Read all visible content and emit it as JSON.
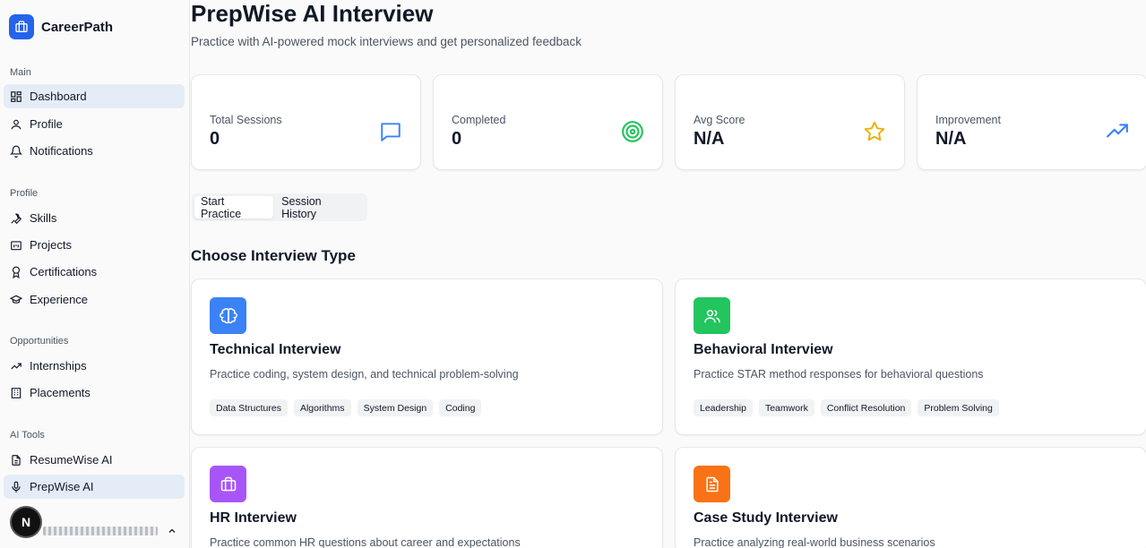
{
  "brand": {
    "name": "CareerPath",
    "color": "#2563eb"
  },
  "sidebar": {
    "sections": [
      {
        "label": "Main"
      },
      {
        "label": "Profile"
      },
      {
        "label": "Opportunities"
      },
      {
        "label": "AI Tools"
      }
    ],
    "items": [
      {
        "label": "Dashboard",
        "icon": "dashboard-icon",
        "active": true
      },
      {
        "label": "Profile",
        "icon": "user-icon"
      },
      {
        "label": "Notifications",
        "icon": "bell-icon"
      },
      {
        "label": "Skills",
        "icon": "wrench-icon"
      },
      {
        "label": "Projects",
        "icon": "folder-icon"
      },
      {
        "label": "Certifications",
        "icon": "award-icon"
      },
      {
        "label": "Experience",
        "icon": "graduation-cap-icon"
      },
      {
        "label": "Internships",
        "icon": "trending-up-icon"
      },
      {
        "label": "Placements",
        "icon": "building-icon"
      },
      {
        "label": "ResumeWise AI",
        "icon": "file-text-icon"
      },
      {
        "label": "PrepWise AI",
        "icon": "mic-icon",
        "active": true
      }
    ],
    "footer": {
      "avatar_letter": "N"
    }
  },
  "header": {
    "title": "PrepWise AI Interview",
    "subtitle": "Practice with AI-powered mock interviews and get personalized feedback"
  },
  "stats": [
    {
      "label": "Total Sessions",
      "value": "0",
      "icon": "message-square-icon",
      "color": "#3b82f6"
    },
    {
      "label": "Completed",
      "value": "0",
      "icon": "target-icon",
      "color": "#22c55e"
    },
    {
      "label": "Avg Score",
      "value": "N/A",
      "icon": "star-icon",
      "color": "#eab308"
    },
    {
      "label": "Improvement",
      "value": "N/A",
      "icon": "trending-up-icon",
      "color": "#3b82f6"
    }
  ],
  "tabs": [
    {
      "label": "Start Practice",
      "active": true
    },
    {
      "label": "Session History"
    }
  ],
  "section_title": "Choose Interview Type",
  "interview_types": [
    {
      "title": "Technical Interview",
      "description": "Practice coding, system design, and technical problem-solving",
      "icon": "brain-icon",
      "color": "#3b82f6",
      "tags": [
        "Data Structures",
        "Algorithms",
        "System Design",
        "Coding"
      ]
    },
    {
      "title": "Behavioral Interview",
      "description": "Practice STAR method responses for behavioral questions",
      "icon": "users-icon",
      "color": "#22c55e",
      "tags": [
        "Leadership",
        "Teamwork",
        "Conflict Resolution",
        "Problem Solving"
      ]
    },
    {
      "title": "HR Interview",
      "description": "Practice common HR questions about career and expectations",
      "icon": "briefcase-icon",
      "color": "#a855f7",
      "tags": []
    },
    {
      "title": "Case Study Interview",
      "description": "Practice analyzing real-world business scenarios",
      "icon": "file-text-icon",
      "color": "#f97316",
      "tags": []
    }
  ]
}
